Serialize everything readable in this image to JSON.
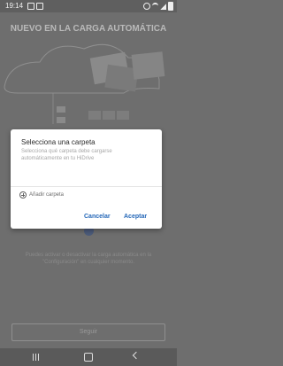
{
  "status_bar": {
    "time": "19:14"
  },
  "background": {
    "title": "NUEVO EN LA CARGA AUTOMÁTICA",
    "hint": "Puedes activar o desactivar la carga automática en la \"Configuración\" en cualquier momento.",
    "button_label": "Seguir"
  },
  "dialog": {
    "title": "Selecciona una carpeta",
    "subtitle": "Selecciona qué carpeta debe cargarse automáticamente en tu HiDrive",
    "add_folder_label": "Añadir carpeta",
    "cancel_label": "Cancelar",
    "accept_label": "Aceptar"
  },
  "colors": {
    "accent": "#2467b8",
    "scrim": "#6e6e6e"
  }
}
